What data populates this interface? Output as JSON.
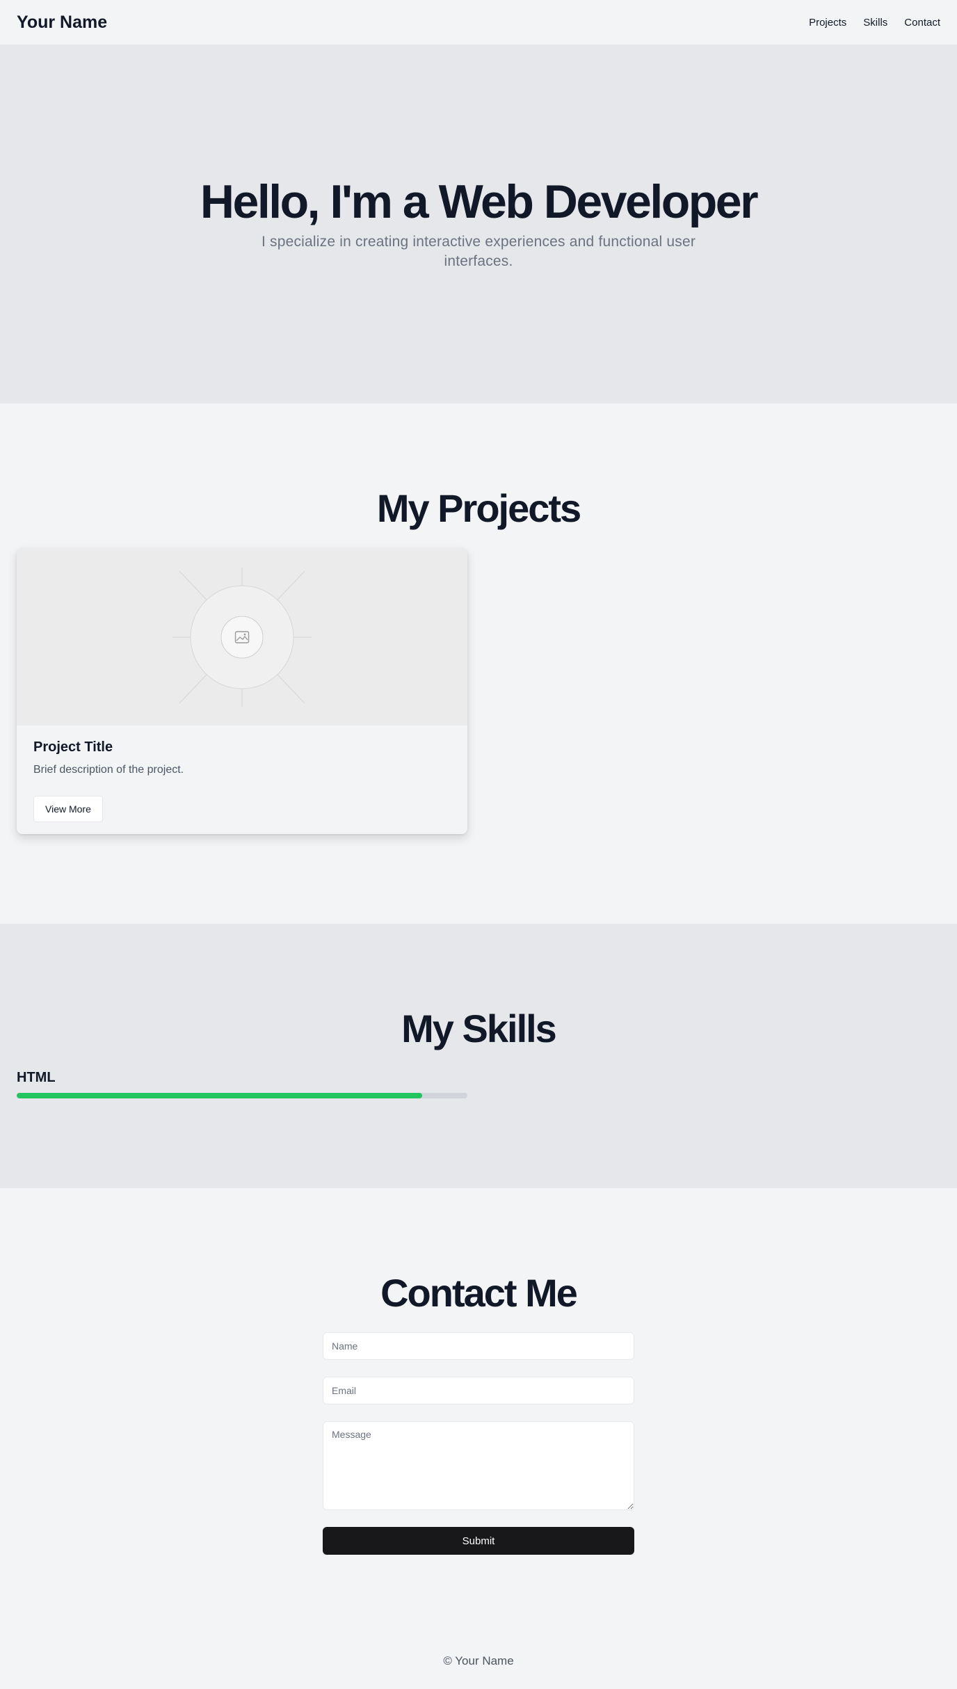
{
  "header": {
    "brand": "Your Name",
    "nav": [
      "Projects",
      "Skills",
      "Contact"
    ]
  },
  "hero": {
    "title": "Hello, I'm a Web Developer",
    "subtitle": "I specialize in creating interactive experiences and functional user interfaces."
  },
  "projects": {
    "title": "My Projects",
    "cards": [
      {
        "image_icon": "image-placeholder-icon",
        "title": "Project Title",
        "description": "Brief description of the project.",
        "button_label": "View More"
      }
    ]
  },
  "skills": {
    "title": "My Skills",
    "items": [
      {
        "name": "HTML",
        "level_percent": 90
      }
    ],
    "bar_color": "#22c55e"
  },
  "contact": {
    "title": "Contact Me",
    "name_placeholder": "Name",
    "email_placeholder": "Email",
    "message_placeholder": "Message",
    "submit_label": "Submit"
  },
  "footer": {
    "text": "© Your Name"
  },
  "colors": {
    "background": "#f3f4f6",
    "section_alt": "#e5e7eb",
    "heading": "#111827",
    "button_dark": "#18181b"
  }
}
